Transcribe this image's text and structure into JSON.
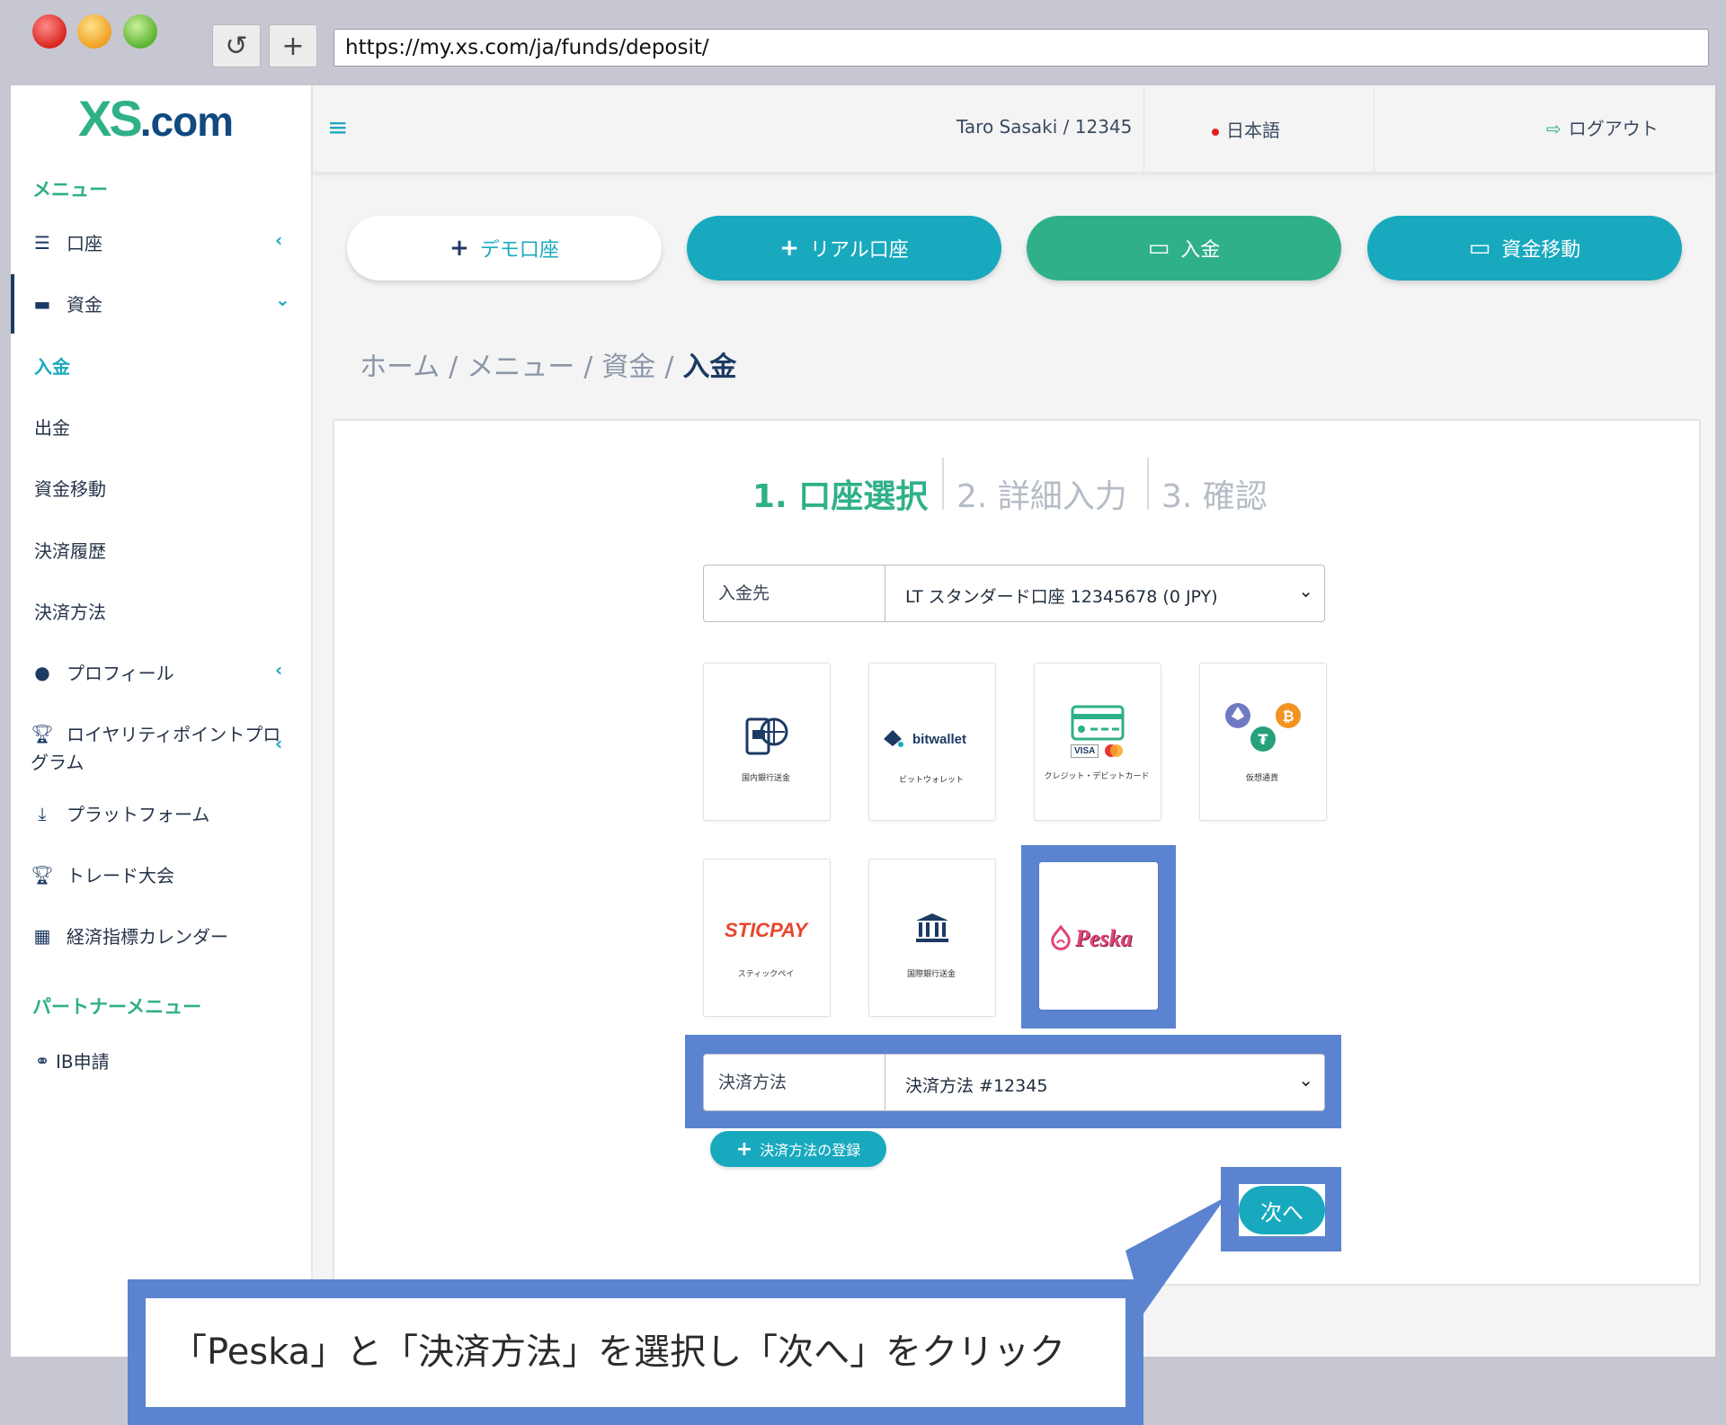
{
  "browser": {
    "url": "https://my.xs.com/ja/funds/deposit/",
    "reload_symbol": "↺",
    "newtab_symbol": "+"
  },
  "logo": {
    "brand": "XS",
    "suffix": ".com"
  },
  "sidebar": {
    "menu_heading": "メニュー",
    "items": [
      {
        "label": "口座",
        "icon": "list-icon"
      },
      {
        "label": "資金",
        "icon": "wallet-icon"
      },
      {
        "label": "プロフィール",
        "icon": "user-icon"
      },
      {
        "label": "ロイヤリティポイントプロ",
        "label2": "グラム",
        "icon": "trophy-icon"
      },
      {
        "label": "プラットフォーム",
        "icon": "download-icon"
      },
      {
        "label": "トレード大会",
        "icon": "trophy-icon"
      },
      {
        "label": "経済指標カレンダー",
        "icon": "calendar-icon"
      }
    ],
    "sub_items": [
      "入金",
      "出金",
      "資金移動",
      "決済履歴",
      "決済方法"
    ],
    "partner_heading": "パートナーメニュー",
    "partner_items": [
      {
        "label": "IB申請",
        "icon": "handshake-icon"
      }
    ]
  },
  "topbar": {
    "user": "Taro Sasaki / 12345",
    "language": "日本語",
    "logout": "ログアウト"
  },
  "actions": {
    "demo": "デモ口座",
    "real": "リアル口座",
    "deposit": "入金",
    "transfer": "資金移動"
  },
  "breadcrumb": {
    "home": "ホーム",
    "menu": "メニュー",
    "funds": "資金",
    "current": "入金",
    "sep": "/"
  },
  "steps": {
    "s1": "1. 口座選択",
    "s2": "2. 詳細入力",
    "s3": "3. 確認"
  },
  "deposit_to": {
    "label": "入金先",
    "value": "LT スタンダード口座 12345678 (0 JPY)"
  },
  "methods": [
    {
      "caption": "国内銀行送金",
      "icon": "bank-transfer-icon"
    },
    {
      "caption": "ビットウォレット",
      "brand": "bitwallet",
      "icon": "bitwallet-icon"
    },
    {
      "caption": "クレジット・デビットカード",
      "icon": "credit-card-icon",
      "badges": [
        "VISA"
      ]
    },
    {
      "caption": "仮想通貨",
      "icon": "crypto-icon"
    },
    {
      "caption": "スティックペイ",
      "brand": "STICPAY",
      "icon": "sticpay-icon"
    },
    {
      "caption": "国際銀行送金",
      "icon": "bank-icon"
    },
    {
      "caption": "",
      "brand": "Peska",
      "icon": "peska-icon",
      "selected": true
    }
  ],
  "payment_method": {
    "label": "決済方法",
    "value": "決済方法 #12345"
  },
  "register_method": "決済方法の登録",
  "next": "次へ",
  "callout": "「Peska」と「決済方法」を選択し「次へ」をクリック",
  "colors": {
    "teal": "#18a9be",
    "green": "#2fb089",
    "navy": "#1c3a63",
    "highlight": "#5b83cf"
  }
}
